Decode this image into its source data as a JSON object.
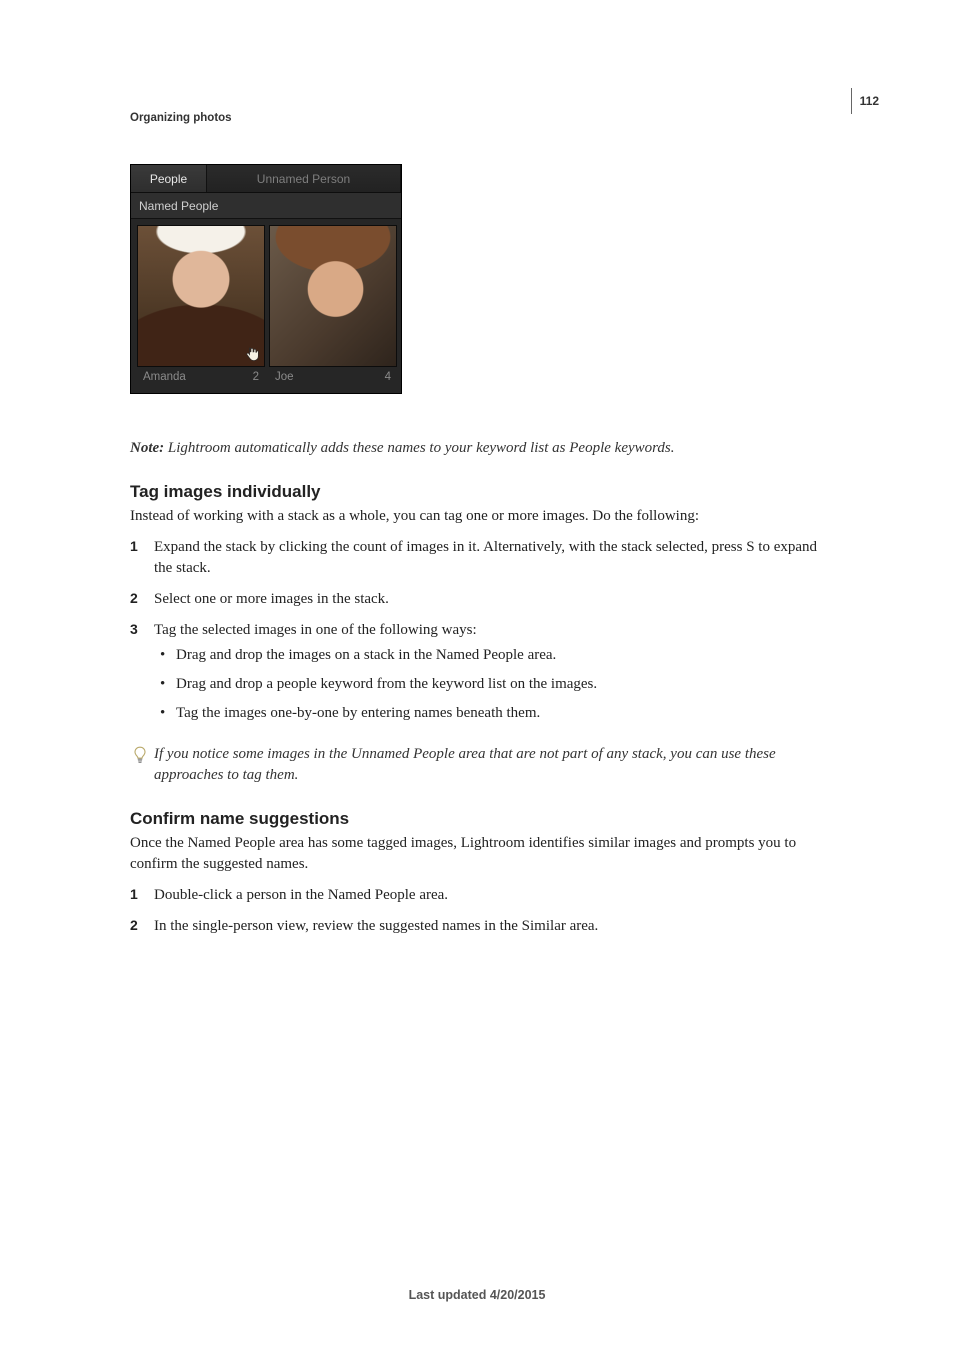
{
  "page_number": "112",
  "running_head": "Organizing photos",
  "panel": {
    "tabs": {
      "active": "People",
      "inactive": "Unnamed Person"
    },
    "subhead": "Named People",
    "thumbs": [
      {
        "name": "Amanda",
        "count": "2"
      },
      {
        "name": "Joe",
        "count": "4"
      }
    ]
  },
  "note": {
    "label": "Note:",
    "text": "Lightroom automatically adds these names to your keyword list as People keywords."
  },
  "section1": {
    "heading": "Tag images individually",
    "intro": "Instead of working with a stack as a whole, you can tag one or more images. Do the following:",
    "steps": [
      "Expand the stack by clicking the count of images in it. Alternatively, with the stack selected, press S to expand the stack.",
      "Select one or more images in the stack.",
      "Tag the selected images in one of the following ways:"
    ],
    "sublist": [
      "Drag and drop the images on a stack in the Named People area.",
      "Drag and drop a people keyword from the keyword list on the images.",
      "Tag the images one-by-one by entering names beneath them."
    ],
    "tip": "If you notice some images in the Unnamed People area that are not part of any stack, you can use these approaches to tag them."
  },
  "section2": {
    "heading": "Confirm name suggestions",
    "intro": "Once the Named People area has some tagged images, Lightroom identifies similar images and prompts you to confirm the suggested names.",
    "steps": [
      "Double-click a person in the Named People area.",
      "In the single-person view, review the suggested names in the Similar area."
    ]
  },
  "footer": "Last updated 4/20/2015"
}
